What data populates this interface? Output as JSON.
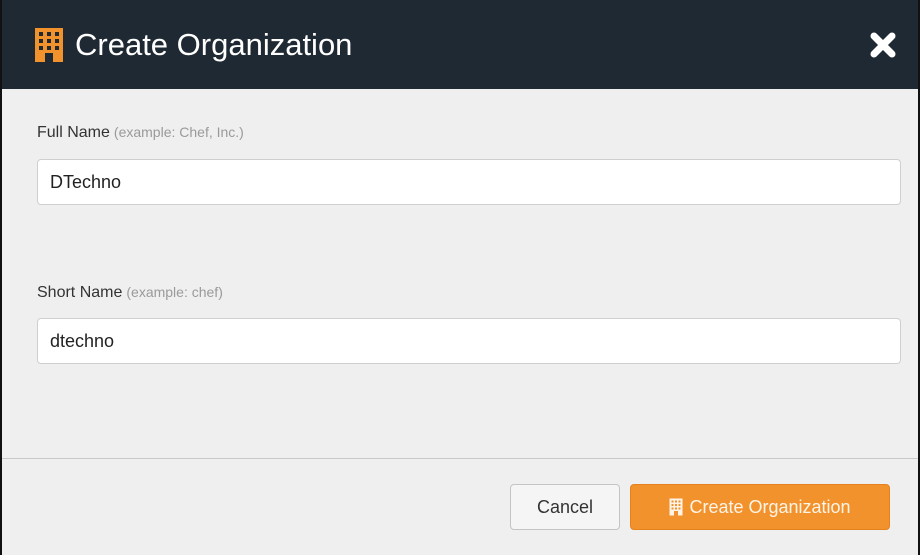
{
  "dialog": {
    "title": "Create Organization",
    "title_icon": "building-icon",
    "close_icon": "close-icon"
  },
  "fields": {
    "full_name": {
      "label": "Full Name",
      "hint": "(example: Chef, Inc.)",
      "value": "DTechno"
    },
    "short_name": {
      "label": "Short Name",
      "hint": "(example: chef)",
      "value": "dtechno"
    }
  },
  "footer": {
    "cancel_label": "Cancel",
    "create_label": "Create Organization",
    "create_icon": "building-icon"
  },
  "colors": {
    "header_bg": "#1f2933",
    "accent": "#f2922d",
    "body_bg": "#efefef"
  }
}
